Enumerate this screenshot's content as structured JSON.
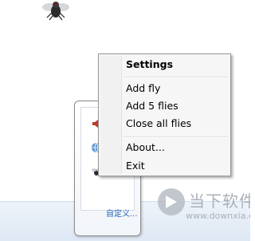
{
  "menu": {
    "items": [
      {
        "label": "Settings",
        "bold": true
      },
      {
        "label": "Add fly"
      },
      {
        "label": "Add 5 flies"
      },
      {
        "label": "Close all flies"
      },
      {
        "label": "About..."
      },
      {
        "label": "Exit"
      }
    ]
  },
  "tray": {
    "link_label": "自定义..."
  },
  "watermark": {
    "title": "当下软件园",
    "url": "www.downxia.com"
  },
  "icons": {
    "fly": "fly-icon",
    "speaker": "speaker-icon",
    "network": "network-icon",
    "watermark_logo": "play-logo-icon"
  }
}
